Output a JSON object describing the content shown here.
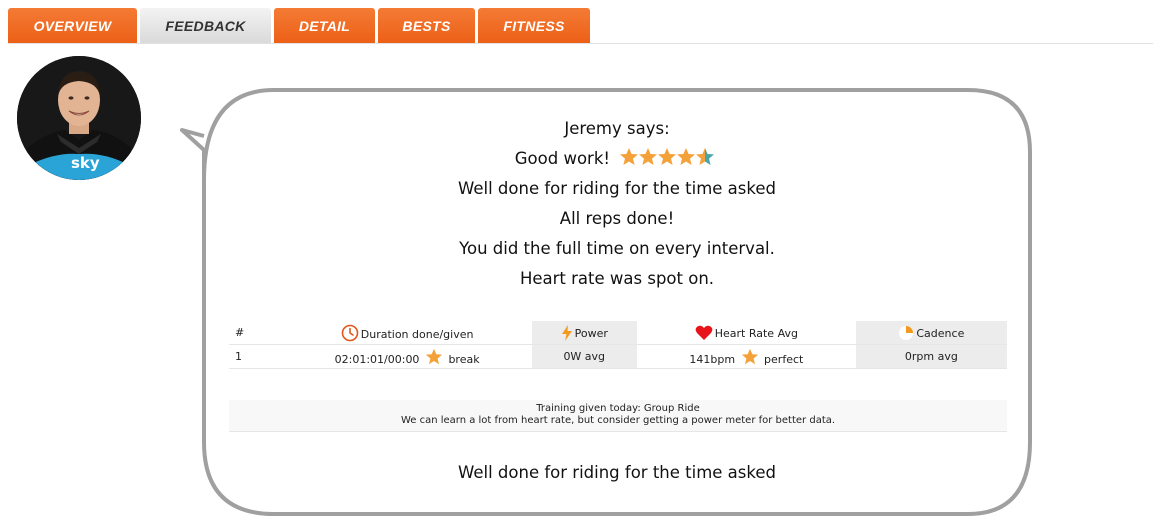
{
  "tabs": [
    {
      "label": "OVERVIEW",
      "active": false
    },
    {
      "label": "FEEDBACK",
      "active": true
    },
    {
      "label": "DETAIL",
      "active": false
    },
    {
      "label": "BESTS",
      "active": false
    },
    {
      "label": "FITNESS",
      "active": false
    }
  ],
  "avatar": {
    "jersey_text": "sky"
  },
  "feedback": {
    "speaker": "Jeremy says:",
    "rating_text": "Good work!",
    "rating_stars": 4.5,
    "lines": [
      "Well done for riding for the time asked",
      "All reps done!",
      "You did the full time on every interval.",
      "Heart rate was spot on."
    ]
  },
  "table": {
    "headers": {
      "index": "#",
      "duration": "Duration done/given",
      "power": "Power",
      "heart_rate": "Heart Rate Avg",
      "cadence": "Cadence"
    },
    "rows": [
      {
        "index": "1",
        "duration": "02:01:01/00:00",
        "duration_note": "break",
        "power": "0W avg",
        "heart_rate": "141bpm",
        "heart_rate_note": "perfect",
        "cadence": "0rpm avg"
      }
    ]
  },
  "note": {
    "training": "Training given today: Group Ride",
    "advice": "We can learn a lot from heart rate, but consider getting a power meter for better data."
  },
  "closing": "Well done for riding for the time asked",
  "colors": {
    "tab_orange": "#ec5f16",
    "star_orange": "#f4a13a",
    "star_teal": "#4aa6a6",
    "heart_red": "#e8141c",
    "bubble_border": "#a0a0a0"
  }
}
